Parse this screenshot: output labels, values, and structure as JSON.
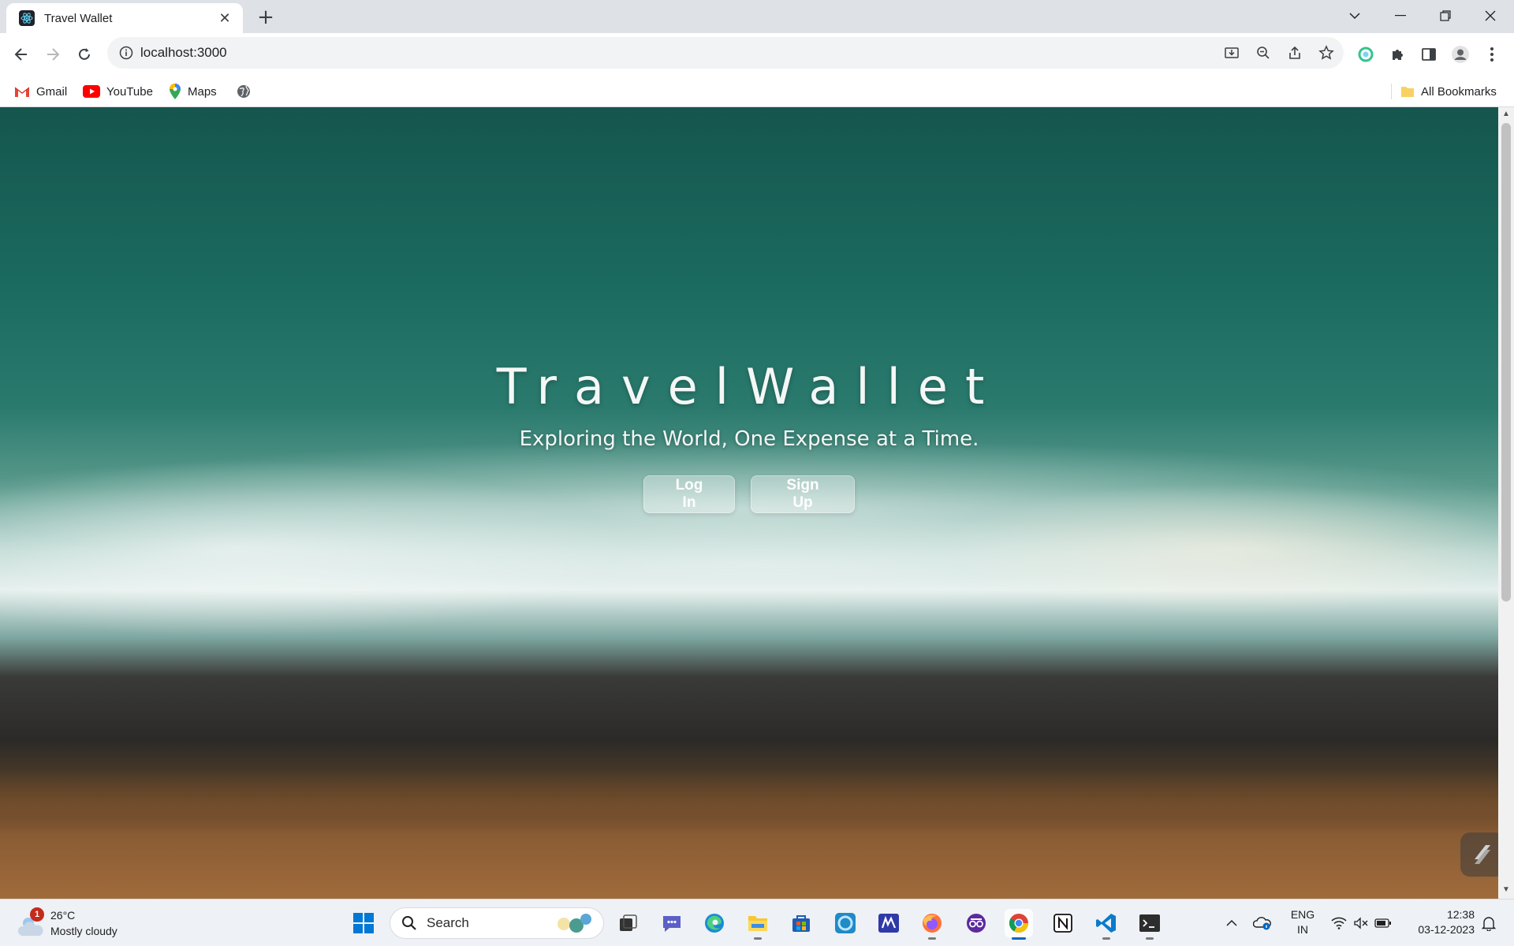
{
  "browser": {
    "tab_title": "Travel Wallet",
    "tab_close": "✕",
    "new_tab": "+",
    "url": "localhost:3000",
    "bookmarks": [
      {
        "label": "Gmail",
        "icon": "gmail-icon"
      },
      {
        "label": "YouTube",
        "icon": "youtube-icon"
      },
      {
        "label": "Maps",
        "icon": "maps-icon"
      }
    ],
    "all_bookmarks_label": "All Bookmarks"
  },
  "page": {
    "title": "TravelWallet",
    "tagline": "Exploring the World, One Expense at a Time.",
    "login_label": "Log In",
    "signup_label": "Sign Up"
  },
  "taskbar": {
    "weather_badge": "1",
    "weather_temp": "26°C",
    "weather_desc": "Mostly cloudy",
    "search_label": "Search",
    "lang_line1": "ENG",
    "lang_line2": "IN",
    "time": "12:38",
    "date": "03-12-2023"
  },
  "colors": {
    "accent": "#0067c0",
    "button_bg": "rgba(255,255,255,0.32)",
    "title_color": "#f4f7f6"
  }
}
